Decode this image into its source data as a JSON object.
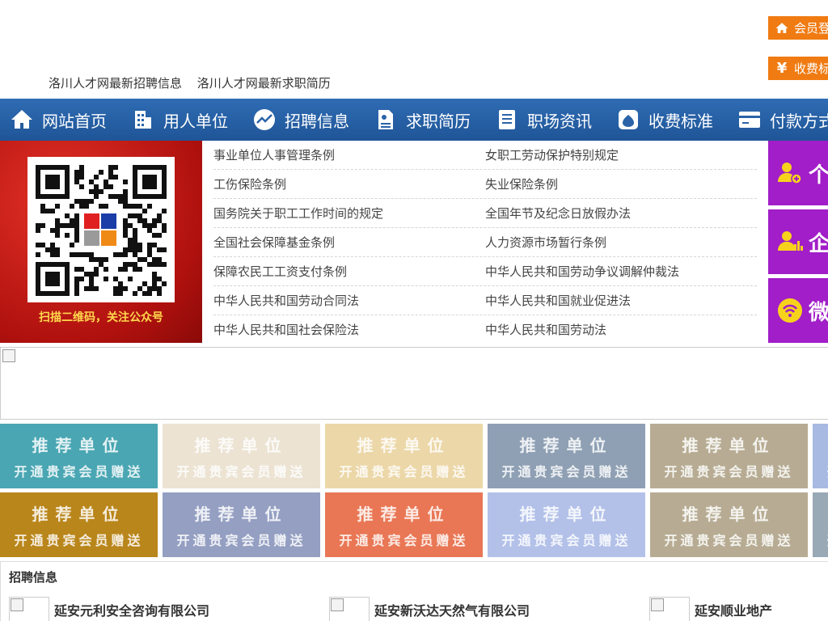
{
  "header": {
    "links": [
      "洛川人才网最新招聘信息",
      "洛川人才网最新求职简历"
    ],
    "login_label": "会员登",
    "fee_label": "收费标",
    "fee_symbol": "¥"
  },
  "nav": [
    {
      "label": "网站首页",
      "icon": "home-icon"
    },
    {
      "label": "用人单位",
      "icon": "building-icon"
    },
    {
      "label": "招聘信息",
      "icon": "chart-icon"
    },
    {
      "label": "求职简历",
      "icon": "resume-icon"
    },
    {
      "label": "职场资讯",
      "icon": "news-icon"
    },
    {
      "label": "收费标准",
      "icon": "moneybag-icon"
    },
    {
      "label": "付款方式",
      "icon": "card-icon"
    }
  ],
  "qr": {
    "caption": "扫描二维码，关注公众号"
  },
  "laws": [
    [
      "事业单位人事管理条例",
      "女职工劳动保护特别规定"
    ],
    [
      "工伤保险条例",
      "失业保险条例"
    ],
    [
      "国务院关于职工工作时间的规定",
      "全国年节及纪念日放假办法"
    ],
    [
      "全国社会保障基金条例",
      "人力资源市场暂行条例"
    ],
    [
      "保障农民工工资支付条例",
      "中华人民共和国劳动争议调解仲裁法"
    ],
    [
      "中华人民共和国劳动合同法",
      "中华人民共和国就业促进法"
    ],
    [
      "中华人民共和国社会保险法",
      "中华人民共和国劳动法"
    ]
  ],
  "side_buttons": [
    {
      "label": "个",
      "icon": "person-add-icon"
    },
    {
      "label": "企",
      "icon": "person-chart-icon"
    },
    {
      "label": "微",
      "icon": "wechat-icon"
    }
  ],
  "recommend": {
    "title": "推荐单位",
    "subtitle": "开通贵宾会员赠送",
    "row1_colors": [
      "#4aa6b3",
      "#ece3d3",
      "#ecd7a8",
      "#8fa0b4",
      "#b7ac93",
      "#a8b9e2"
    ],
    "row2_colors": [
      "#b9861b",
      "#949fc2",
      "#e97755",
      "#b3c1e9",
      "#b7ac93",
      "#9aa9b6"
    ]
  },
  "jobs": {
    "title": "招聘信息",
    "companies": [
      "延安元利安全咨询有限公司",
      "延安新沃达天然气有限公司",
      "延安顺业地产"
    ]
  }
}
